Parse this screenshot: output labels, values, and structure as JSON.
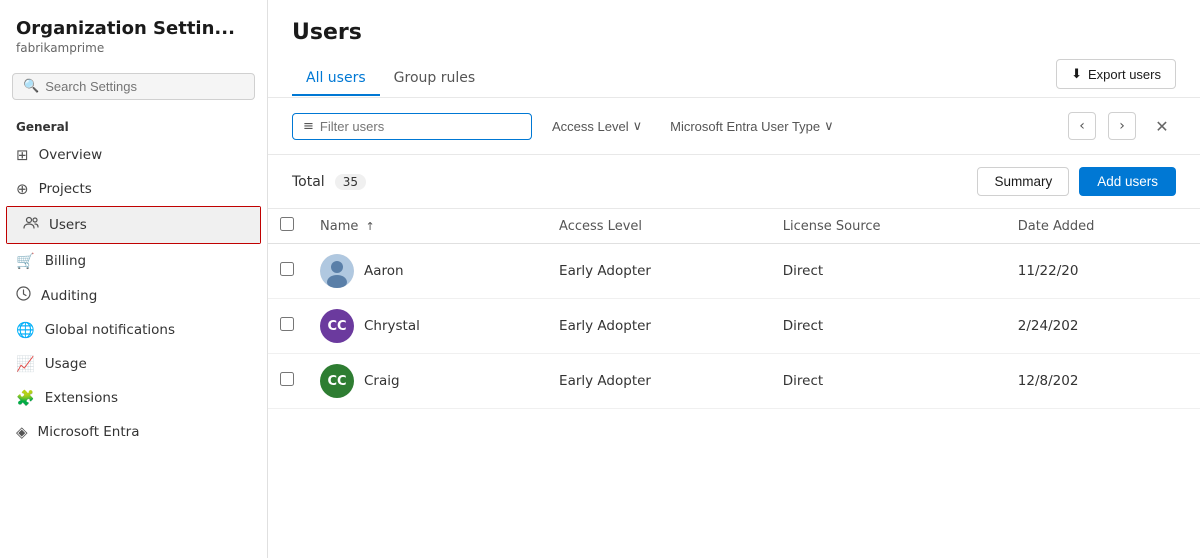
{
  "sidebar": {
    "title": "Organization Settin...",
    "subtitle": "fabrikamprime",
    "search_placeholder": "Search Settings",
    "section_label": "General",
    "items": [
      {
        "id": "overview",
        "label": "Overview",
        "icon": "⊞"
      },
      {
        "id": "projects",
        "label": "Projects",
        "icon": "⊕"
      },
      {
        "id": "users",
        "label": "Users",
        "icon": "👥",
        "active": true
      },
      {
        "id": "billing",
        "label": "Billing",
        "icon": "🛒"
      },
      {
        "id": "auditing",
        "label": "Auditing",
        "icon": "🔔"
      },
      {
        "id": "global-notifications",
        "label": "Global notifications",
        "icon": "🔔"
      },
      {
        "id": "usage",
        "label": "Usage",
        "icon": "📊"
      },
      {
        "id": "extensions",
        "label": "Extensions",
        "icon": "🧩"
      },
      {
        "id": "microsoft-entra",
        "label": "Microsoft Entra",
        "icon": "◈"
      }
    ]
  },
  "main": {
    "title": "Users",
    "tabs": [
      {
        "id": "all-users",
        "label": "All users",
        "active": true
      },
      {
        "id": "group-rules",
        "label": "Group rules",
        "active": false
      }
    ],
    "export_button": "Export users",
    "filter": {
      "placeholder": "Filter users",
      "access_level_label": "Access Level",
      "user_type_label": "Microsoft Entra User Type"
    },
    "table": {
      "total_label": "Total",
      "total_count": "35",
      "summary_button": "Summary",
      "add_users_button": "Add users",
      "columns": [
        {
          "id": "name",
          "label": "Name",
          "sort": "↑"
        },
        {
          "id": "access-level",
          "label": "Access Level"
        },
        {
          "id": "license-source",
          "label": "License Source"
        },
        {
          "id": "date-added",
          "label": "Date Added"
        }
      ],
      "rows": [
        {
          "name": "Aaron",
          "avatar_initials": "",
          "avatar_color": "#5a7fa8",
          "avatar_type": "image",
          "access_level": "Early Adopter",
          "license_source": "Direct",
          "date_added": "11/22/20"
        },
        {
          "name": "Chrystal",
          "avatar_initials": "CC",
          "avatar_color": "#6b3a9e",
          "avatar_type": "initials",
          "access_level": "Early Adopter",
          "license_source": "Direct",
          "date_added": "2/24/202"
        },
        {
          "name": "Craig",
          "avatar_initials": "CC",
          "avatar_color": "#2e7d32",
          "avatar_type": "initials",
          "access_level": "Early Adopter",
          "license_source": "Direct",
          "date_added": "12/8/202"
        }
      ]
    }
  }
}
